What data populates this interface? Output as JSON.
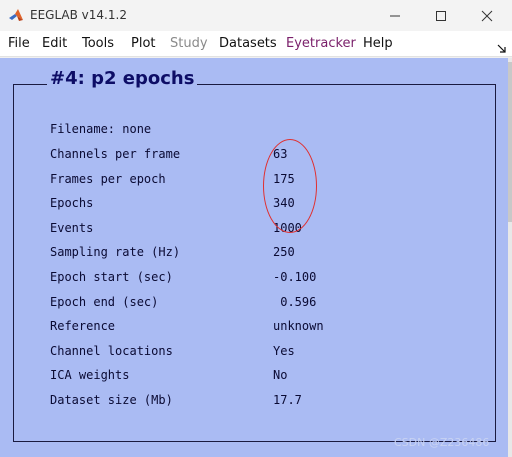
{
  "window": {
    "title": "EEGLAB v14.1.2",
    "app_icon": "matlab-icon",
    "controls": {
      "minimize": "minimize-icon",
      "maximize": "maximize-icon",
      "close": "close-icon"
    }
  },
  "menu": {
    "items": [
      {
        "label": "File"
      },
      {
        "label": "Edit"
      },
      {
        "label": "Tools"
      },
      {
        "label": "Plot"
      },
      {
        "label": "Study"
      },
      {
        "label": "Datasets"
      },
      {
        "label": "Eyetracker"
      },
      {
        "label": "Help"
      }
    ],
    "overflow_icon": "dock-arrow-icon"
  },
  "panel": {
    "title": "#4: p2 epochs",
    "rows": [
      {
        "label": "Filename: none",
        "value": ""
      },
      {
        "label": "Channels per frame",
        "value": "63"
      },
      {
        "label": "Frames per epoch",
        "value": "175"
      },
      {
        "label": "Epochs",
        "value": "340"
      },
      {
        "label": "Events",
        "value": "1000"
      },
      {
        "label": "Sampling rate (Hz)",
        "value": "250"
      },
      {
        "label": "Epoch start (sec)",
        "value": "-0.100"
      },
      {
        "label": "Epoch end (sec)",
        "value": " 0.596"
      },
      {
        "label": "Reference",
        "value": "unknown"
      },
      {
        "label": "Channel locations",
        "value": "Yes"
      },
      {
        "label": "ICA weights",
        "value": "No"
      },
      {
        "label": "Dataset size (Mb)",
        "value": "17.7"
      }
    ]
  },
  "watermark": "CSDN @Z236486",
  "colors": {
    "panel_background": "#aabbf3",
    "title_text": "#0d0d66",
    "annotation": "#e03030",
    "disabled_menu": "#8a8a8a",
    "eyetracker_menu": "#7a1f6a"
  }
}
